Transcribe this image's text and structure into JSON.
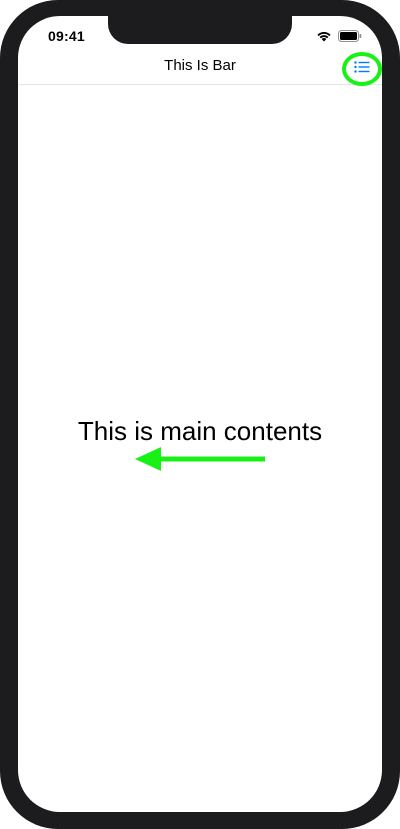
{
  "status_bar": {
    "time": "09:41",
    "wifi_icon": "wifi-icon",
    "battery_icon": "battery-icon"
  },
  "nav_bar": {
    "title": "This Is Bar",
    "menu_icon": "list-icon"
  },
  "main": {
    "text": "This is main contents"
  },
  "colors": {
    "accent": "#007aff",
    "highlight": "#19f016"
  }
}
